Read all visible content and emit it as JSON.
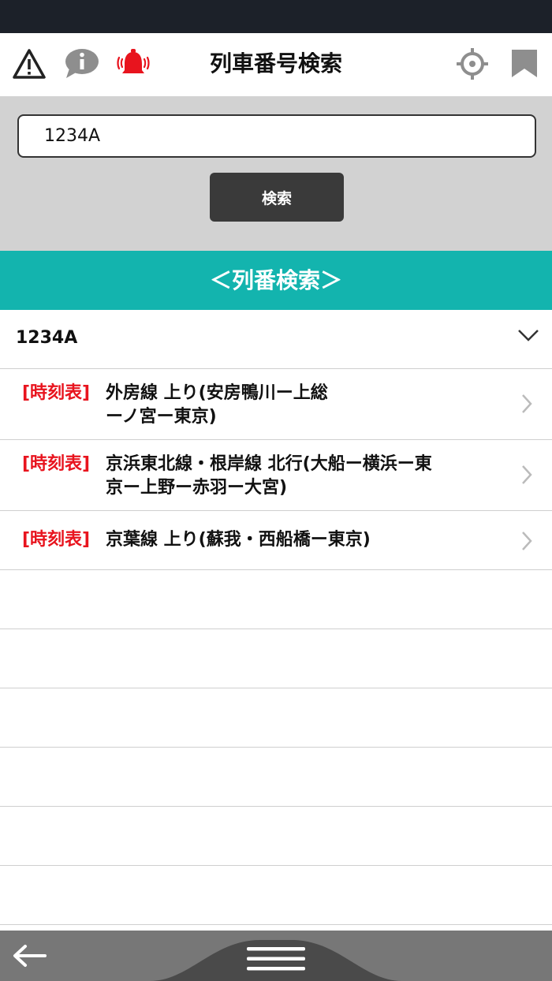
{
  "header": {
    "title": "列車番号検索",
    "icons": [
      "warning-icon",
      "info-icon",
      "alarm-bell-icon",
      "location-target-icon",
      "bookmark-icon"
    ],
    "colors": {
      "alarm": "#e8141e",
      "info": "#8e8e8e",
      "dark": "#222222"
    }
  },
  "search": {
    "value": "1234A",
    "button_label": "検索"
  },
  "section": {
    "title": "＜列番検索＞",
    "color": "#13b4ae"
  },
  "results": {
    "group_title": "1234A",
    "items": [
      {
        "tag": "[時刻表]",
        "lines": [
          "外房線 上り(安房鴨川ー上総",
          "ーノ宮ー東京)"
        ]
      },
      {
        "tag": "[時刻表]",
        "lines": [
          "京浜東北線・根岸線 北行(大船ー横浜ー東",
          "京ー上野ー赤羽ー大宮)"
        ]
      },
      {
        "tag": "[時刻表]",
        "lines": [
          "京葉線 上り(蘇我・西船橋ー東京)"
        ]
      }
    ],
    "tag_color": "#e8141e"
  },
  "bottom_bar": {
    "icons": [
      "back-arrow-icon",
      "hamburger-menu-icon"
    ]
  }
}
